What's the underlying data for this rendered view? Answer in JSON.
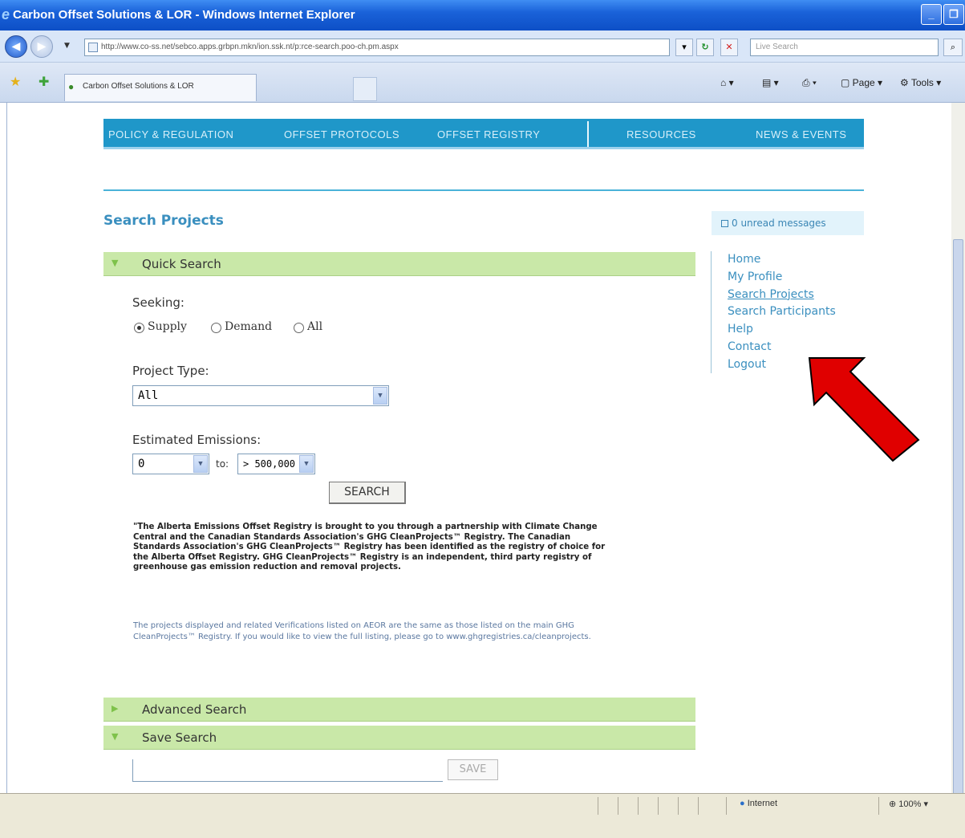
{
  "browser": {
    "title": "Carbon Offset Solutions & LOR - Windows Internet Explorer",
    "address": "http://www.co-ss.net/sebco.apps.grbpn.mkn/ion.ssk.nt/p:rce-search.poo-ch.pm.aspx",
    "search_placeholder": "Live Search",
    "tab_label": "Carbon Offset Solutions & LOR",
    "commands": {
      "page": "Page",
      "tools": "Tools"
    },
    "status_zone": "Internet",
    "zoom": "100%"
  },
  "site_nav": {
    "items": [
      "POLICY & REGULATION",
      "OFFSET PROTOCOLS",
      "OFFSET REGISTRY",
      "RESOURCES",
      "NEWS & EVENTS"
    ]
  },
  "page": {
    "title": "Search Projects",
    "quick_search": {
      "header": "Quick Search",
      "seeking_label": "Seeking:",
      "options": [
        "Supply",
        "Demand",
        "All"
      ],
      "selected": "Supply",
      "project_type_label": "Project Type:",
      "project_type_value": "All",
      "estimated_emissions_label": "Estimated Emissions:",
      "emissions_from": "0",
      "to_label": "to:",
      "emissions_to": "> 500,000",
      "search_button": "SEARCH",
      "description_1": "\"The Alberta Emissions Offset Registry is brought to you through a partnership with Climate Change Central and the Canadian Standards Association's GHG CleanProjects™ Registry. The Canadian Standards Association's GHG CleanProjects™ Registry has been identified as the registry of choice for the Alberta Offset Registry. GHG CleanProjects™ Registry is an independent, third party registry of greenhouse gas emission reduction and removal projects.",
      "description_2": "The projects displayed and related Verifications listed on AEOR are the same as those listed on the main GHG CleanProjects™ Registry. If you would like to view the full listing, please go to www.ghgregistries.ca/cleanprojects."
    },
    "advanced_search": {
      "header": "Advanced Search"
    },
    "save_search": {
      "header": "Save Search",
      "input_value": "",
      "button": "SAVE"
    }
  },
  "sidebar": {
    "messages": "0 unread messages",
    "links": [
      "Home",
      "My Profile",
      "Search Projects",
      "Search Participants",
      "Help",
      "Contact",
      "Logout"
    ],
    "current": "Search Projects"
  },
  "colors": {
    "nav_bg": "#1f97c9",
    "section_bar": "#c9e8a8",
    "link": "#3a8fbf",
    "annotation_arrow": "#e00000"
  }
}
